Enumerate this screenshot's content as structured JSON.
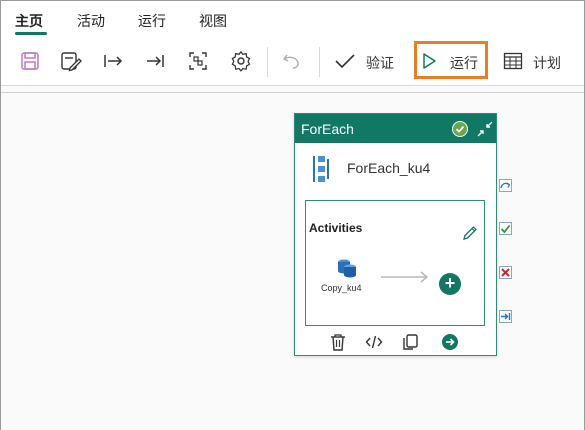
{
  "tabs": [
    {
      "label": "主页",
      "active": true
    },
    {
      "label": "活动",
      "active": false
    },
    {
      "label": "运行",
      "active": false
    },
    {
      "label": "视图",
      "active": false
    }
  ],
  "toolbar": {
    "icons": [
      "save-icon",
      "save-as-template-icon",
      "move-start-icon",
      "move-end-icon",
      "fit-view-icon",
      "settings-icon",
      "undo-icon"
    ],
    "validate_label": "验证",
    "run_label": "运行",
    "schedule_label": "计划"
  },
  "node": {
    "type": "ForEach",
    "name": "ForEach_ku4",
    "activities_title": "Activities",
    "inner_activity": "Copy_ku4"
  },
  "colors": {
    "accent": "#117865",
    "highlight": "#ef7d1d",
    "success": "#2d9a3c",
    "failure": "#c62828",
    "skip": "#2a6fb8"
  },
  "side_handles": [
    "completion-icon",
    "success-icon",
    "failure-icon",
    "skip-icon"
  ]
}
